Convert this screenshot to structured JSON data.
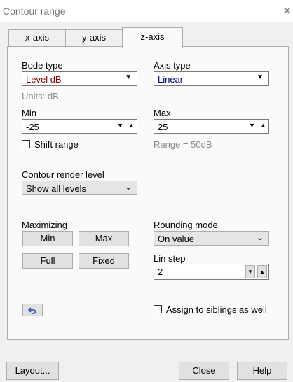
{
  "window": {
    "title": "Contour range"
  },
  "tabs": [
    {
      "label": "x-axis"
    },
    {
      "label": "y-axis"
    },
    {
      "label": "z-axis",
      "active": true
    }
  ],
  "bode_type": {
    "label": "Bode type",
    "value": "Level dB",
    "units": "Units: dB"
  },
  "axis_type": {
    "label": "Axis type",
    "value": "Linear"
  },
  "min": {
    "label": "Min",
    "value": "-25"
  },
  "max": {
    "label": "Max",
    "value": "25",
    "range_text": "Range = 50dB"
  },
  "shift_range": {
    "label": "Shift range",
    "checked": false
  },
  "contour_render": {
    "label": "Contour render level",
    "value": "Show all levels"
  },
  "maximizing": {
    "label": "Maximizing",
    "buttons": [
      "Min",
      "Max",
      "Full",
      "Fixed"
    ]
  },
  "rounding": {
    "label": "Rounding mode",
    "value": "On value"
  },
  "lin_step": {
    "label": "Lin step",
    "value": "2"
  },
  "assign_siblings": {
    "label": "Assign to siblings as well",
    "checked": false
  },
  "footer": {
    "layout": "Layout...",
    "close": "Close",
    "help": "Help"
  },
  "colors": {
    "bode_value": "#8b0000",
    "axis_value": "#000080"
  }
}
